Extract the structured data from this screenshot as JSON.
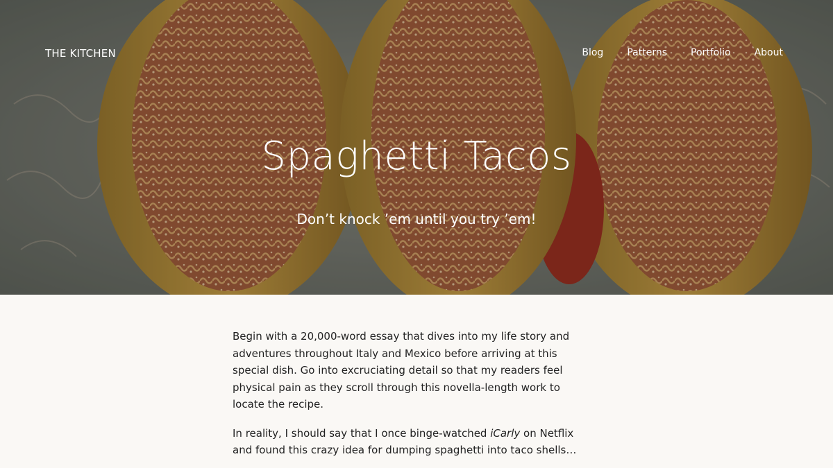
{
  "site": {
    "title": "THE KITCHEN"
  },
  "nav": {
    "items": [
      {
        "label": "Blog"
      },
      {
        "label": "Patterns"
      },
      {
        "label": "Portfolio"
      },
      {
        "label": "About"
      }
    ]
  },
  "hero": {
    "title": "Spaghetti Tacos",
    "subtitle": "Don’t knock ’em until you try ’em!",
    "image": "spaghetti-tacos-photo"
  },
  "content": {
    "paragraph1": "Begin with a 20,000-word essay that dives into my life story and adventures throughout Italy and Mexico before arriving at this special dish. Go into excruciating detail so that my readers feel physical pain as they scroll through this novella-length work to locate the recipe.",
    "paragraph2_before": "In reality, I should say that I once binge-watched ",
    "paragraph2_em": "iCarly",
    "paragraph2_after": " on Netflix and found this crazy idea for dumping spaghetti into taco shells…"
  },
  "colors": {
    "page_background": "#faf8f5",
    "text": "#222222",
    "hero_text": "#ffffff"
  }
}
